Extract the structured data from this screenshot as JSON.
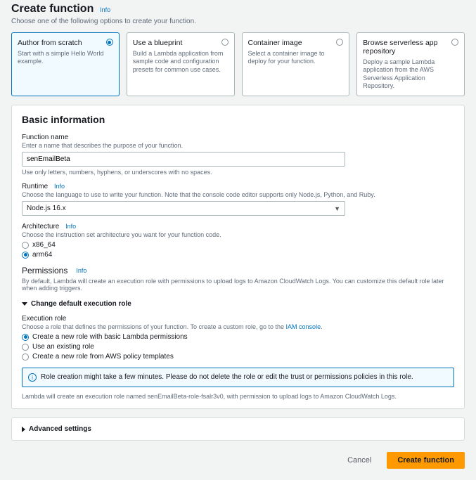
{
  "page": {
    "title": "Create function",
    "info": "Info",
    "subtitle": "Choose one of the following options to create your function."
  },
  "options": [
    {
      "title": "Author from scratch",
      "desc": "Start with a simple Hello World example."
    },
    {
      "title": "Use a blueprint",
      "desc": "Build a Lambda application from sample code and configuration presets for common use cases."
    },
    {
      "title": "Container image",
      "desc": "Select a container image to deploy for your function."
    },
    {
      "title": "Browse serverless app repository",
      "desc": "Deploy a sample Lambda application from the AWS Serverless Application Repository."
    }
  ],
  "basic": {
    "heading": "Basic information",
    "fnname_label": "Function name",
    "fnname_sub": "Enter a name that describes the purpose of your function.",
    "fnname_value": "senEmailBeta",
    "fnname_help": "Use only letters, numbers, hyphens, or underscores with no spaces.",
    "runtime_label": "Runtime",
    "runtime_sub": "Choose the language to use to write your function. Note that the console code editor supports only Node.js, Python, and Ruby.",
    "runtime_value": "Node.js 16.x",
    "arch_label": "Architecture",
    "arch_sub": "Choose the instruction set architecture you want for your function code.",
    "arch_x86": "x86_64",
    "arch_arm": "arm64",
    "perm_title": "Permissions",
    "perm_desc": "By default, Lambda will create an execution role with permissions to upload logs to Amazon CloudWatch Logs. You can customize this default role later when adding triggers.",
    "change_role": "Change default execution role",
    "exec_role_label": "Execution role",
    "exec_role_sub_pre": "Choose a role that defines the permissions of your function. To create a custom role, go to the ",
    "exec_role_sub_link": "IAM console",
    "exec_role_sub_post": ".",
    "role_opt1": "Create a new role with basic Lambda permissions",
    "role_opt2": "Use an existing role",
    "role_opt3": "Create a new role from AWS policy templates",
    "role_info": "Role creation might take a few minutes. Please do not delete the role or edit the trust or permissions policies in this role.",
    "role_gen": "Lambda will create an execution role named senEmailBeta-role-fsalr3v0, with permission to upload logs to Amazon CloudWatch Logs."
  },
  "adv": {
    "heading": "Advanced settings"
  },
  "footer": {
    "cancel": "Cancel",
    "create": "Create function"
  }
}
